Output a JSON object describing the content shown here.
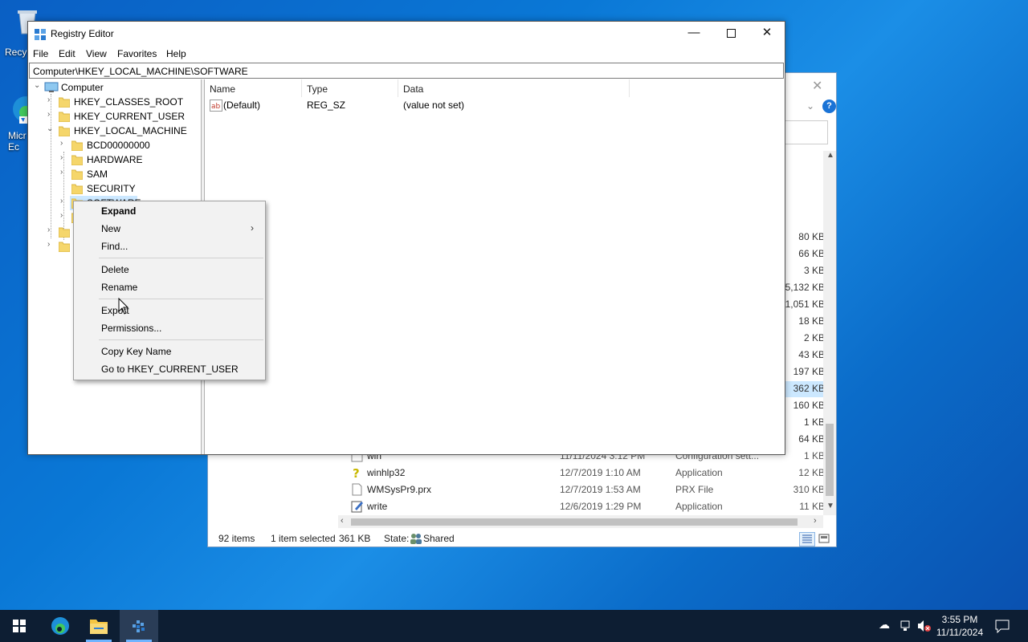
{
  "desktop": {
    "icons": [
      {
        "label": "Recy",
        "icon": "recycle-bin-icon"
      },
      {
        "label": "Micr Ec",
        "icon": "edge-shortcut-icon"
      }
    ]
  },
  "explorer": {
    "rows": [
      {
        "name": "win",
        "date": "11/11/2024 3:12 PM",
        "type": "Configuration sett...",
        "size": "1 KB"
      },
      {
        "name": "winhlp32",
        "date": "12/7/2019 1:10 AM",
        "type": "Application",
        "size": "12 KB"
      },
      {
        "name": "WMSysPr9.prx",
        "date": "12/7/2019 1:53 AM",
        "type": "PRX File",
        "size": "310 KB"
      },
      {
        "name": "write",
        "date": "12/6/2019 1:29 PM",
        "type": "Application",
        "size": "11 KB"
      }
    ],
    "sizes_above": [
      "80 KB",
      "66 KB",
      "3 KB",
      "5,132 KB",
      "1,051 KB",
      "18 KB",
      "2 KB",
      "43 KB",
      "197 KB",
      "362 KB",
      "160 KB",
      "1 KB",
      "64 KB"
    ],
    "status": {
      "items": "92 items",
      "selected": "1 item selected",
      "size": "361 KB",
      "state_label": "State:",
      "state_value": "Shared"
    }
  },
  "regedit": {
    "title": "Registry Editor",
    "menu": [
      "File",
      "Edit",
      "View",
      "Favorites",
      "Help"
    ],
    "address": "Computer\\HKEY_LOCAL_MACHINE\\SOFTWARE",
    "tree": {
      "root": "Computer",
      "hives": [
        "HKEY_CLASSES_ROOT",
        "HKEY_CURRENT_USER",
        "HKEY_LOCAL_MACHINE"
      ],
      "hklm_children": [
        "BCD00000000",
        "HARDWARE",
        "SAM",
        "SECURITY",
        "SOFTWARE"
      ]
    },
    "columns": {
      "name": "Name",
      "type": "Type",
      "data": "Data"
    },
    "values": [
      {
        "name": "(Default)",
        "type": "REG_SZ",
        "data": "(value not set)"
      }
    ]
  },
  "context_menu": {
    "expand": "Expand",
    "new": "New",
    "find": "Find...",
    "delete": "Delete",
    "rename": "Rename",
    "export": "Export",
    "permissions": "Permissions...",
    "copy_key_name": "Copy Key Name",
    "goto": "Go to HKEY_CURRENT_USER"
  },
  "taskbar": {
    "time": "3:55 PM",
    "date": "11/11/2024",
    "apps": [
      "windows-start-icon",
      "edge-icon",
      "file-explorer-icon",
      "registry-editor-icon"
    ]
  }
}
